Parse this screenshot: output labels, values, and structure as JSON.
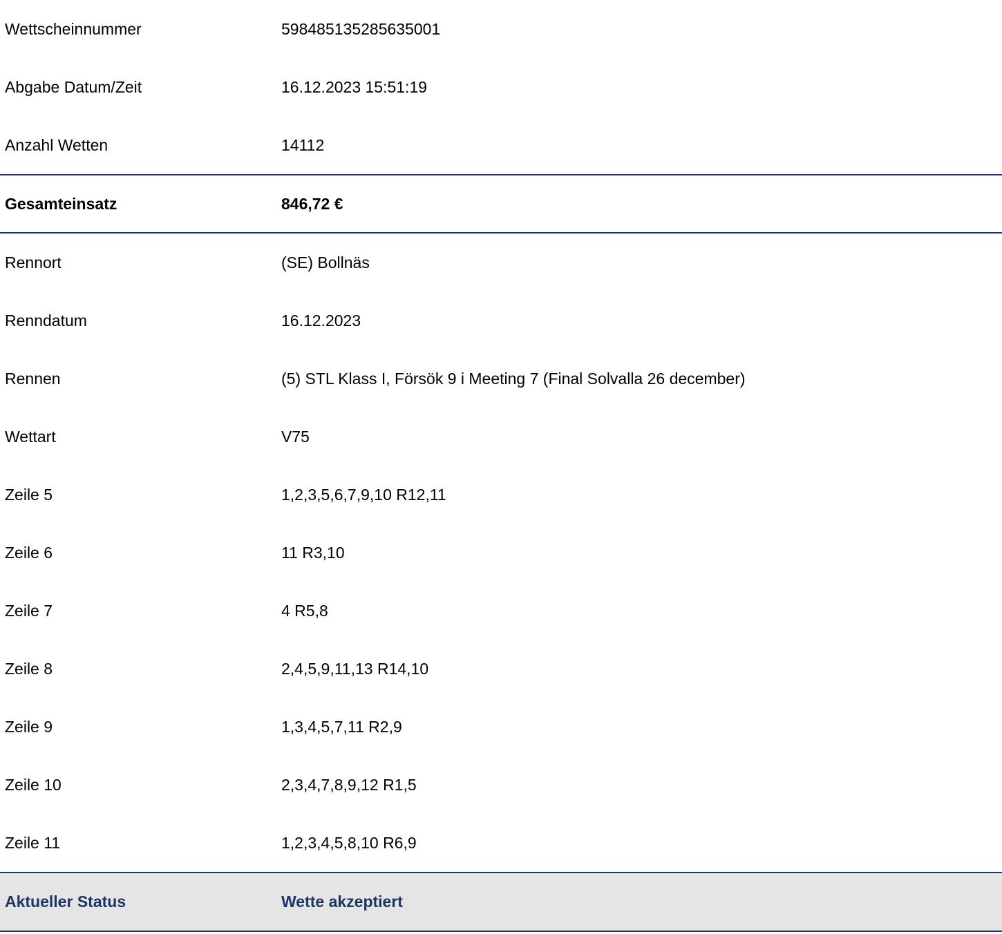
{
  "header_rows": [
    {
      "label": "Wettscheinnummer",
      "value": "598485135285635001"
    },
    {
      "label": "Abgabe Datum/Zeit",
      "value": "16.12.2023 15:51:19"
    },
    {
      "label": "Anzahl Wetten",
      "value": "14112"
    }
  ],
  "total": {
    "label": "Gesamteinsatz",
    "value": "846,72 €"
  },
  "detail_rows": [
    {
      "label": "Rennort",
      "value": "(SE) Bollnäs"
    },
    {
      "label": "Renndatum",
      "value": "16.12.2023"
    },
    {
      "label": "Rennen",
      "value": "(5) STL Klass I, Försök 9 i Meeting 7 (Final Solvalla 26 december)"
    },
    {
      "label": "Wettart",
      "value": "V75"
    },
    {
      "label": "Zeile 5",
      "value": "1,2,3,5,6,7,9,10 R12,11"
    },
    {
      "label": "Zeile 6",
      "value": "11 R3,10"
    },
    {
      "label": "Zeile 7",
      "value": "4 R5,8"
    },
    {
      "label": "Zeile 8",
      "value": "2,4,5,9,11,13 R14,10"
    },
    {
      "label": "Zeile 9",
      "value": "1,3,4,5,7,11 R2,9"
    },
    {
      "label": "Zeile 10",
      "value": "2,3,4,7,8,9,12 R1,5"
    },
    {
      "label": "Zeile 11",
      "value": "1,2,3,4,5,8,10 R6,9"
    }
  ],
  "status": {
    "label": "Aktueller Status",
    "value": "Wette akzeptiert"
  },
  "colors": {
    "accent": "#1f3566",
    "status_bg": "#e5e5e5"
  }
}
